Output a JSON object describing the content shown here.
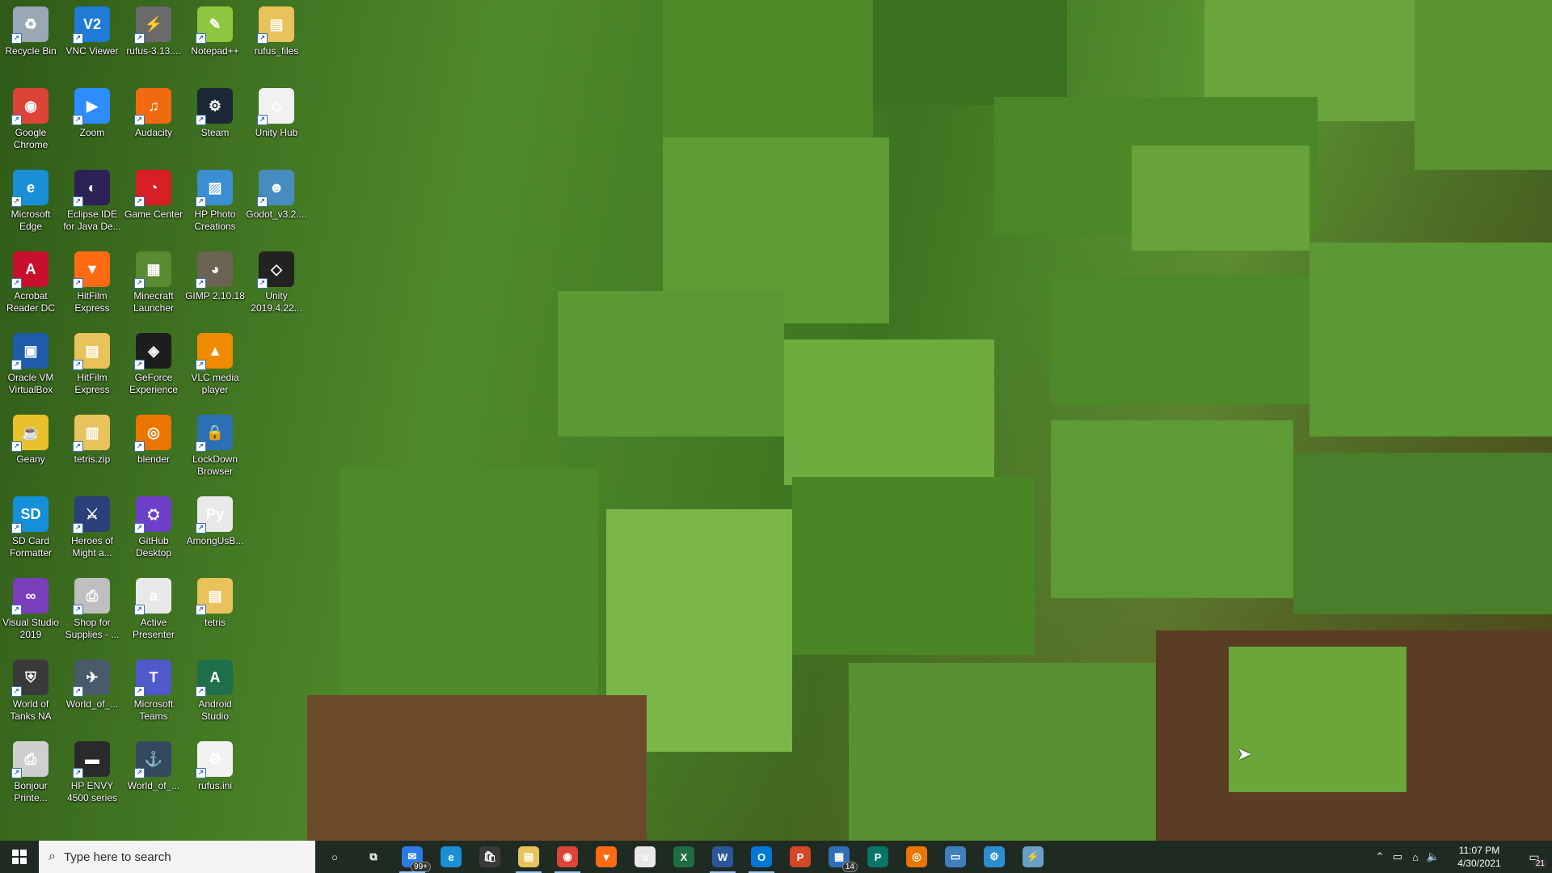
{
  "desktop": {
    "icons": [
      {
        "label": "Recycle Bin",
        "icon": "recycle-bin-icon",
        "color": "#9aa7b4",
        "glyph": "♻"
      },
      {
        "label": "Google\nChrome",
        "icon": "chrome-icon",
        "color": "#db4437",
        "glyph": "◉"
      },
      {
        "label": "Microsoft\nEdge",
        "icon": "edge-icon",
        "color": "#1a8fd6",
        "glyph": "e"
      },
      {
        "label": "Acrobat\nReader DC",
        "icon": "acrobat-icon",
        "color": "#c8102e",
        "glyph": "A"
      },
      {
        "label": "Oracle VM\nVirtualBox",
        "icon": "virtualbox-icon",
        "color": "#1e5ba8",
        "glyph": "▣"
      },
      {
        "label": "Geany",
        "icon": "geany-icon",
        "color": "#e9c12b",
        "glyph": "☕"
      },
      {
        "label": "SD Card\nFormatter",
        "icon": "sd-card-icon",
        "color": "#1490d8",
        "glyph": "SD"
      },
      {
        "label": "Visual Studio\n2019",
        "icon": "visual-studio-icon",
        "color": "#7a3dbb",
        "glyph": "∞"
      },
      {
        "label": "World of\nTanks NA",
        "icon": "world-of-tanks-icon",
        "color": "#3a3a3a",
        "glyph": "⛨"
      },
      {
        "label": "Bonjour\nPrinte...",
        "icon": "printer-icon",
        "color": "#cfcfcf",
        "glyph": "⎙"
      },
      {
        "label": "VNC Viewer",
        "icon": "vnc-icon",
        "color": "#1f7bd6",
        "glyph": "V2"
      },
      {
        "label": "Zoom",
        "icon": "zoom-icon",
        "color": "#2d8cff",
        "glyph": "▶"
      },
      {
        "label": "Eclipse IDE\nfor Java De...",
        "icon": "eclipse-icon",
        "color": "#2c2255",
        "glyph": "◐"
      },
      {
        "label": "HitFilm\nExpress",
        "icon": "hitfilm-icon",
        "color": "#ff6a13",
        "glyph": "▼"
      },
      {
        "label": "HitFilm\nExpress",
        "icon": "folder-icon",
        "color": "#e8c25a",
        "glyph": "▤"
      },
      {
        "label": "tetris.zip",
        "icon": "zip-folder-icon",
        "color": "#e8c25a",
        "glyph": "▥"
      },
      {
        "label": "Heroes of\nMight a...",
        "icon": "heroes-icon",
        "color": "#2b3f7a",
        "glyph": "⚔"
      },
      {
        "label": "Shop for\nSupplies - ...",
        "icon": "shop-supplies-icon",
        "color": "#bfbfbf",
        "glyph": "⎙"
      },
      {
        "label": "World_of_...",
        "icon": "world-of-warplanes-icon",
        "color": "#4a5a6a",
        "glyph": "✈"
      },
      {
        "label": "HP ENVY\n4500 series",
        "icon": "hp-printer-icon",
        "color": "#2a2a2a",
        "glyph": "▬"
      },
      {
        "label": "rufus-3.13....",
        "icon": "rufus-icon",
        "color": "#6a6a6a",
        "glyph": "⚡"
      },
      {
        "label": "Audacity",
        "icon": "audacity-icon",
        "color": "#f26a0f",
        "glyph": "♫"
      },
      {
        "label": "Game Center",
        "icon": "game-center-icon",
        "color": "#d81f26",
        "glyph": "◔"
      },
      {
        "label": "Minecraft\nLauncher",
        "icon": "minecraft-icon",
        "color": "#5a8a32",
        "glyph": "▦"
      },
      {
        "label": "GeForce\nExperience",
        "icon": "geforce-icon",
        "color": "#1d1d1d",
        "glyph": "◈"
      },
      {
        "label": "blender",
        "icon": "blender-icon",
        "color": "#ea7600",
        "glyph": "◎"
      },
      {
        "label": "GitHub\nDesktop",
        "icon": "github-icon",
        "color": "#6e40c9",
        "glyph": "⛭"
      },
      {
        "label": "Active\nPresenter",
        "icon": "active-presenter-icon",
        "color": "#e8e8e8",
        "glyph": "a"
      },
      {
        "label": "Microsoft\nTeams",
        "icon": "teams-icon",
        "color": "#5059c9",
        "glyph": "T"
      },
      {
        "label": "World_of_...",
        "icon": "world-of-warships-icon",
        "color": "#34495e",
        "glyph": "⚓"
      },
      {
        "label": "Notepad++",
        "icon": "notepad-plus-icon",
        "color": "#8fc63f",
        "glyph": "✎"
      },
      {
        "label": "Steam",
        "icon": "steam-icon",
        "color": "#1b2838",
        "glyph": "⚙"
      },
      {
        "label": "HP Photo\nCreations",
        "icon": "hp-photo-icon",
        "color": "#3b8fd1",
        "glyph": "▨"
      },
      {
        "label": "GIMP 2.10.18",
        "icon": "gimp-icon",
        "color": "#6b6353",
        "glyph": "◕"
      },
      {
        "label": "VLC media\nplayer",
        "icon": "vlc-icon",
        "color": "#f08a00",
        "glyph": "▲"
      },
      {
        "label": "LockDown\nBrowser",
        "icon": "lockdown-browser-icon",
        "color": "#2c6fb4",
        "glyph": "🔒"
      },
      {
        "label": "AmongUsB...",
        "icon": "python-file-icon",
        "color": "#e9e9e9",
        "glyph": "Py"
      },
      {
        "label": "tetris",
        "icon": "folder-icon",
        "color": "#e8c25a",
        "glyph": "▤"
      },
      {
        "label": "Android\nStudio",
        "icon": "android-studio-icon",
        "color": "#1f6f4a",
        "glyph": "A"
      },
      {
        "label": "rufus.ini",
        "icon": "ini-file-icon",
        "color": "#f2f2f2",
        "glyph": "⚙"
      },
      {
        "label": "rufus_files",
        "icon": "folder-icon",
        "color": "#e8c25a",
        "glyph": "▤"
      },
      {
        "label": "Unity Hub",
        "icon": "unity-hub-icon",
        "color": "#f1f1f1",
        "glyph": "◇"
      },
      {
        "label": "Godot_v3.2....",
        "icon": "godot-icon",
        "color": "#478cbf",
        "glyph": "☻"
      },
      {
        "label": "Unity\n2019.4.22...",
        "icon": "unity-icon",
        "color": "#222222",
        "glyph": "◇"
      }
    ]
  },
  "taskbar": {
    "search_placeholder": "Type here to search",
    "apps": [
      {
        "name": "cortana-icon",
        "glyph": "○",
        "bg": "transparent",
        "badge": ""
      },
      {
        "name": "task-view-icon",
        "glyph": "⧉",
        "bg": "transparent",
        "badge": ""
      },
      {
        "name": "mail-icon",
        "glyph": "✉",
        "bg": "#2c7be5",
        "badge": "99+"
      },
      {
        "name": "edge-icon",
        "glyph": "e",
        "bg": "#1a8fd6",
        "badge": ""
      },
      {
        "name": "store-icon",
        "glyph": "🛍",
        "bg": "#3a3a3a",
        "badge": ""
      },
      {
        "name": "file-explorer-icon",
        "glyph": "▤",
        "bg": "#e8c25a",
        "badge": ""
      },
      {
        "name": "chrome-icon",
        "glyph": "◉",
        "bg": "#db4437",
        "badge": ""
      },
      {
        "name": "hitfilm-icon",
        "glyph": "▼",
        "bg": "#ff6a13",
        "badge": ""
      },
      {
        "name": "active-presenter-icon",
        "glyph": "a",
        "bg": "#e8e8e8",
        "badge": ""
      },
      {
        "name": "excel-icon",
        "glyph": "X",
        "bg": "#1d6f42",
        "badge": ""
      },
      {
        "name": "word-icon",
        "glyph": "W",
        "bg": "#2b579a",
        "badge": ""
      },
      {
        "name": "outlook-icon",
        "glyph": "O",
        "bg": "#0078d4",
        "badge": ""
      },
      {
        "name": "powerpoint-icon",
        "glyph": "P",
        "bg": "#d24726",
        "badge": ""
      },
      {
        "name": "calendar-icon",
        "glyph": "▦",
        "bg": "#2f6fb7",
        "badge": "14"
      },
      {
        "name": "publisher-icon",
        "glyph": "P",
        "bg": "#077568",
        "badge": ""
      },
      {
        "name": "blender-icon",
        "glyph": "◎",
        "bg": "#ea7600",
        "badge": ""
      },
      {
        "name": "remote-desktop-icon",
        "glyph": "▭",
        "bg": "#3f7fc0",
        "badge": ""
      },
      {
        "name": "gear-app-icon",
        "glyph": "⚙",
        "bg": "#2a8fd0",
        "badge": ""
      },
      {
        "name": "rufus-icon",
        "glyph": "⚡",
        "bg": "#6aa0c8",
        "badge": ""
      }
    ],
    "clock_time": "11:07 PM",
    "clock_date": "4/30/2021",
    "notification_count": "21"
  }
}
